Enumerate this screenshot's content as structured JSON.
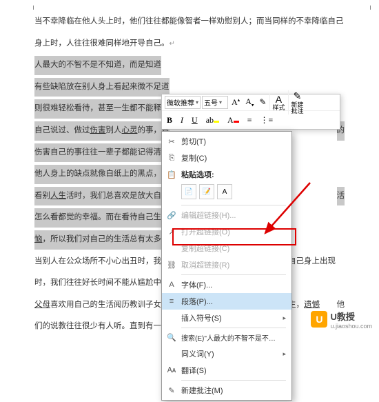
{
  "document": {
    "para1_a": "当不幸降临在他人头上时，他们往往都能像智者一样劝慰别人；而当同样的不幸降临自己",
    "para1_b": "身上时，人往往很难同样地开导自己。",
    "para2_a": "人最大的不智不是不知道，而是知道",
    "para3_a": "有些缺陷放在别人身上看起来微不足道",
    "para3_b": "则很难轻松看待，甚至一生都不能释",
    "para4_a": "自己说过、做过",
    "para4_u": "伤害",
    "para4_b": "别人",
    "para4_u2": "心灵",
    "para4_c": "的事，有",
    "para4_end": "的",
    "para4_d": "伤害自己的事往往一辈子都能记得清清",
    "para5_a": "他人身上的缺点就像白纸上的黑点，一",
    "para6_a": "看别",
    "para6_u": "人生",
    "para6_b": "活时，我们总喜欢是放大自",
    "para6_end": "活",
    "para6_c": "怎么看都觉的幸福。而在看待自己生",
    "para6_u2": "恼",
    "para6_d": "，所以我们对自己的生活总有太多的",
    "para7_a": "当别人在公众场所不小心出丑时，我们往往一笑了之；而当同样的情境在自己身上出现",
    "para7_b": "时，我们往往好长时间不能从尴尬中走出来。",
    "para8_u": "父母",
    "para8_a": "喜欢用自己的生活阅历教训子女，教师喜欢用自己的求学阅历教育学生，",
    "para8_u2": "遗憾",
    "para8_end": "他",
    "para8_b": "们的说教往往很少有人听。直到有一天，历史的一幕重演，"
  },
  "toolbar": {
    "font_name": "微软推荐",
    "font_size": "五号",
    "bold": "B",
    "italic": "I",
    "underline": "U",
    "highlight": "A",
    "styles_label": "样式",
    "new_comment": "新建",
    "new_comment2": "批注"
  },
  "menu": {
    "cut": "剪切(T)",
    "copy": "复制(C)",
    "paste_header": "粘贴选项:",
    "edit_hyperlink": "编辑超链接(H)...",
    "open_hyperlink": "打开超链接(O)",
    "copy_hyperlink": "复制超链接(C)",
    "remove_hyperlink": "取消超链接(R)",
    "font": "字体(F)...",
    "paragraph": "段落(P)...",
    "insert_symbol": "插入符号(S)",
    "search_text": "搜索(E)\"人最大的不智不是不知道，而是知...\"",
    "synonyms": "同义词(Y)",
    "translate": "翻译(S)",
    "new_comment": "新建批注(M)"
  },
  "watermark": {
    "text": "U教授",
    "url": "u.jiaoshou.com"
  }
}
